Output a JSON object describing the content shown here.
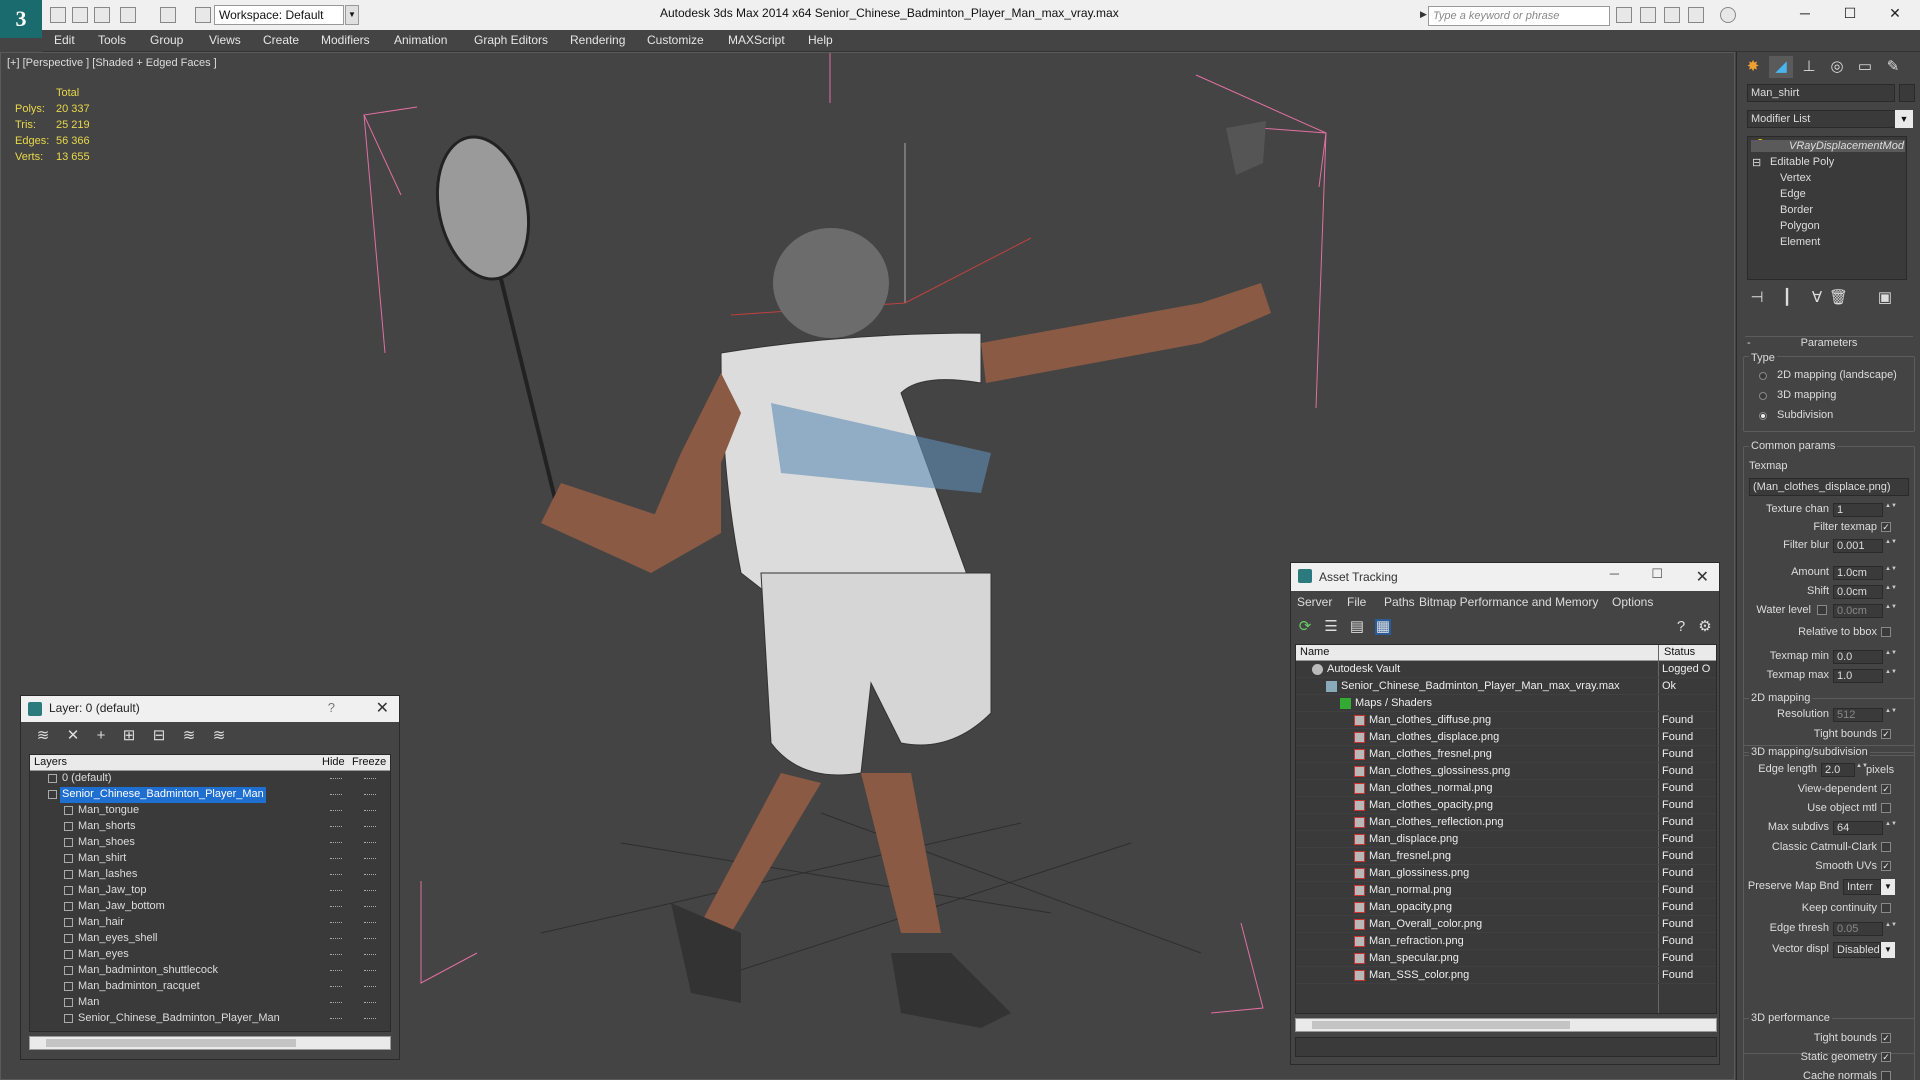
{
  "titlebar": {
    "workspace": "Workspace: Default",
    "app_title": "Autodesk 3ds Max  2014 x64      Senior_Chinese_Badminton_Player_Man_max_vray.max",
    "search_placeholder": "Type a keyword or phrase"
  },
  "menu": [
    "Edit",
    "Tools",
    "Group",
    "Views",
    "Create",
    "Modifiers",
    "Animation",
    "Graph Editors",
    "Rendering",
    "Customize",
    "MAXScript",
    "Help"
  ],
  "viewport": {
    "label": "[+] [Perspective ] [Shaded + Edged Faces ]",
    "stats_header": "Total",
    "stats": [
      {
        "label": "Polys:",
        "value": "20 337"
      },
      {
        "label": "Tris:",
        "value": "25 219"
      },
      {
        "label": "Edges:",
        "value": "56 366"
      },
      {
        "label": "Verts:",
        "value": "13 655"
      }
    ]
  },
  "layer_dialog": {
    "title": "Layer: 0 (default)",
    "help": "?",
    "columns": {
      "layers": "Layers",
      "hide": "Hide",
      "freeze": "Freeze"
    },
    "rows": [
      {
        "name": "0 (default)",
        "indent": 1,
        "selected": false
      },
      {
        "name": "Senior_Chinese_Badminton_Player_Man",
        "indent": 1,
        "selected": true
      },
      {
        "name": "Man_tongue",
        "indent": 2
      },
      {
        "name": "Man_shorts",
        "indent": 2
      },
      {
        "name": "Man_shoes",
        "indent": 2
      },
      {
        "name": "Man_shirt",
        "indent": 2
      },
      {
        "name": "Man_lashes",
        "indent": 2
      },
      {
        "name": "Man_Jaw_top",
        "indent": 2
      },
      {
        "name": "Man_Jaw_bottom",
        "indent": 2
      },
      {
        "name": "Man_hair",
        "indent": 2
      },
      {
        "name": "Man_eyes_shell",
        "indent": 2
      },
      {
        "name": "Man_eyes",
        "indent": 2
      },
      {
        "name": "Man_badminton_shuttlecock",
        "indent": 2
      },
      {
        "name": "Man_badminton_racquet",
        "indent": 2
      },
      {
        "name": "Man",
        "indent": 2
      },
      {
        "name": "Senior_Chinese_Badminton_Player_Man",
        "indent": 2
      }
    ]
  },
  "asset_dialog": {
    "title": "Asset Tracking",
    "menu": [
      "Server",
      "File",
      "Paths",
      "Bitmap Performance and Memory",
      "Options"
    ],
    "columns": {
      "name": "Name",
      "status": "Status"
    },
    "rows": [
      {
        "name": "Autodesk Vault",
        "status": "Logged O",
        "indent": 0,
        "icon": "vault"
      },
      {
        "name": "Senior_Chinese_Badminton_Player_Man_max_vray.max",
        "status": "Ok",
        "indent": 1,
        "icon": "file"
      },
      {
        "name": "Maps / Shaders",
        "status": "",
        "indent": 2,
        "icon": "folder"
      },
      {
        "name": "Man_clothes_diffuse.png",
        "status": "Found",
        "indent": 3,
        "icon": "img"
      },
      {
        "name": "Man_clothes_displace.png",
        "status": "Found",
        "indent": 3,
        "icon": "img"
      },
      {
        "name": "Man_clothes_fresnel.png",
        "status": "Found",
        "indent": 3,
        "icon": "img"
      },
      {
        "name": "Man_clothes_glossiness.png",
        "status": "Found",
        "indent": 3,
        "icon": "img"
      },
      {
        "name": "Man_clothes_normal.png",
        "status": "Found",
        "indent": 3,
        "icon": "img"
      },
      {
        "name": "Man_clothes_opacity.png",
        "status": "Found",
        "indent": 3,
        "icon": "img"
      },
      {
        "name": "Man_clothes_reflection.png",
        "status": "Found",
        "indent": 3,
        "icon": "img"
      },
      {
        "name": "Man_displace.png",
        "status": "Found",
        "indent": 3,
        "icon": "img"
      },
      {
        "name": "Man_fresnel.png",
        "status": "Found",
        "indent": 3,
        "icon": "img"
      },
      {
        "name": "Man_glossiness.png",
        "status": "Found",
        "indent": 3,
        "icon": "img"
      },
      {
        "name": "Man_normal.png",
        "status": "Found",
        "indent": 3,
        "icon": "img"
      },
      {
        "name": "Man_opacity.png",
        "status": "Found",
        "indent": 3,
        "icon": "img"
      },
      {
        "name": "Man_Overall_color.png",
        "status": "Found",
        "indent": 3,
        "icon": "img"
      },
      {
        "name": "Man_refraction.png",
        "status": "Found",
        "indent": 3,
        "icon": "img"
      },
      {
        "name": "Man_specular.png",
        "status": "Found",
        "indent": 3,
        "icon": "img"
      },
      {
        "name": "Man_SSS_color.png",
        "status": "Found",
        "indent": 3,
        "icon": "img"
      }
    ]
  },
  "command_panel": {
    "object_name": "Man_shirt",
    "modifier_list": "Modifier List",
    "stack": [
      "VRayDisplacementMod",
      "Editable Poly",
      "Vertex",
      "Edge",
      "Border",
      "Polygon",
      "Element"
    ],
    "parameters_title": "Parameters",
    "type_label": "Type",
    "type_options": [
      {
        "label": "2D mapping (landscape)",
        "on": false
      },
      {
        "label": "3D mapping",
        "on": false
      },
      {
        "label": "Subdivision",
        "on": true
      }
    ],
    "common_params": "Common params",
    "texmap_label": "Texmap",
    "texmap_value": "(Man_clothes_displace.png)",
    "texture_chan_label": "Texture chan",
    "texture_chan": "1",
    "filter_texmap": "Filter texmap",
    "filter_blur_label": "Filter blur",
    "filter_blur": "0.001",
    "amount_label": "Amount",
    "amount": "1.0cm",
    "shift_label": "Shift",
    "shift": "0.0cm",
    "water_level_label": "Water level",
    "water_level": "0.0cm",
    "relative_bbox": "Relative to bbox",
    "texmap_min_label": "Texmap min",
    "texmap_min": "0.0",
    "texmap_max_label": "Texmap max",
    "texmap_max": "1.0",
    "mapping2d": "2D mapping",
    "resolution_label": "Resolution",
    "resolution": "512",
    "tight_bounds": "Tight bounds",
    "mapping3d": "3D mapping/subdivision",
    "edge_length_label": "Edge length",
    "edge_length": "2.0",
    "pixels": "pixels",
    "view_dependent": "View-dependent",
    "use_object_mtl": "Use object mtl",
    "max_subdivs_label": "Max subdivs",
    "max_subdivs": "64",
    "classic_catmull": "Classic Catmull-Clark",
    "smooth_uvs": "Smooth UVs",
    "preserve_map_label": "Preserve Map Bnd",
    "preserve_map": "Interr",
    "keep_continuity": "Keep continuity",
    "edge_thresh_label": "Edge thresh",
    "edge_thresh": "0.05",
    "vector_displ_label": "Vector displ",
    "vector_displ": "Disabled",
    "performance": "3D performance",
    "perf_tight_bounds": "Tight bounds",
    "static_geometry": "Static geometry",
    "cache_normals": "Cache normals"
  }
}
